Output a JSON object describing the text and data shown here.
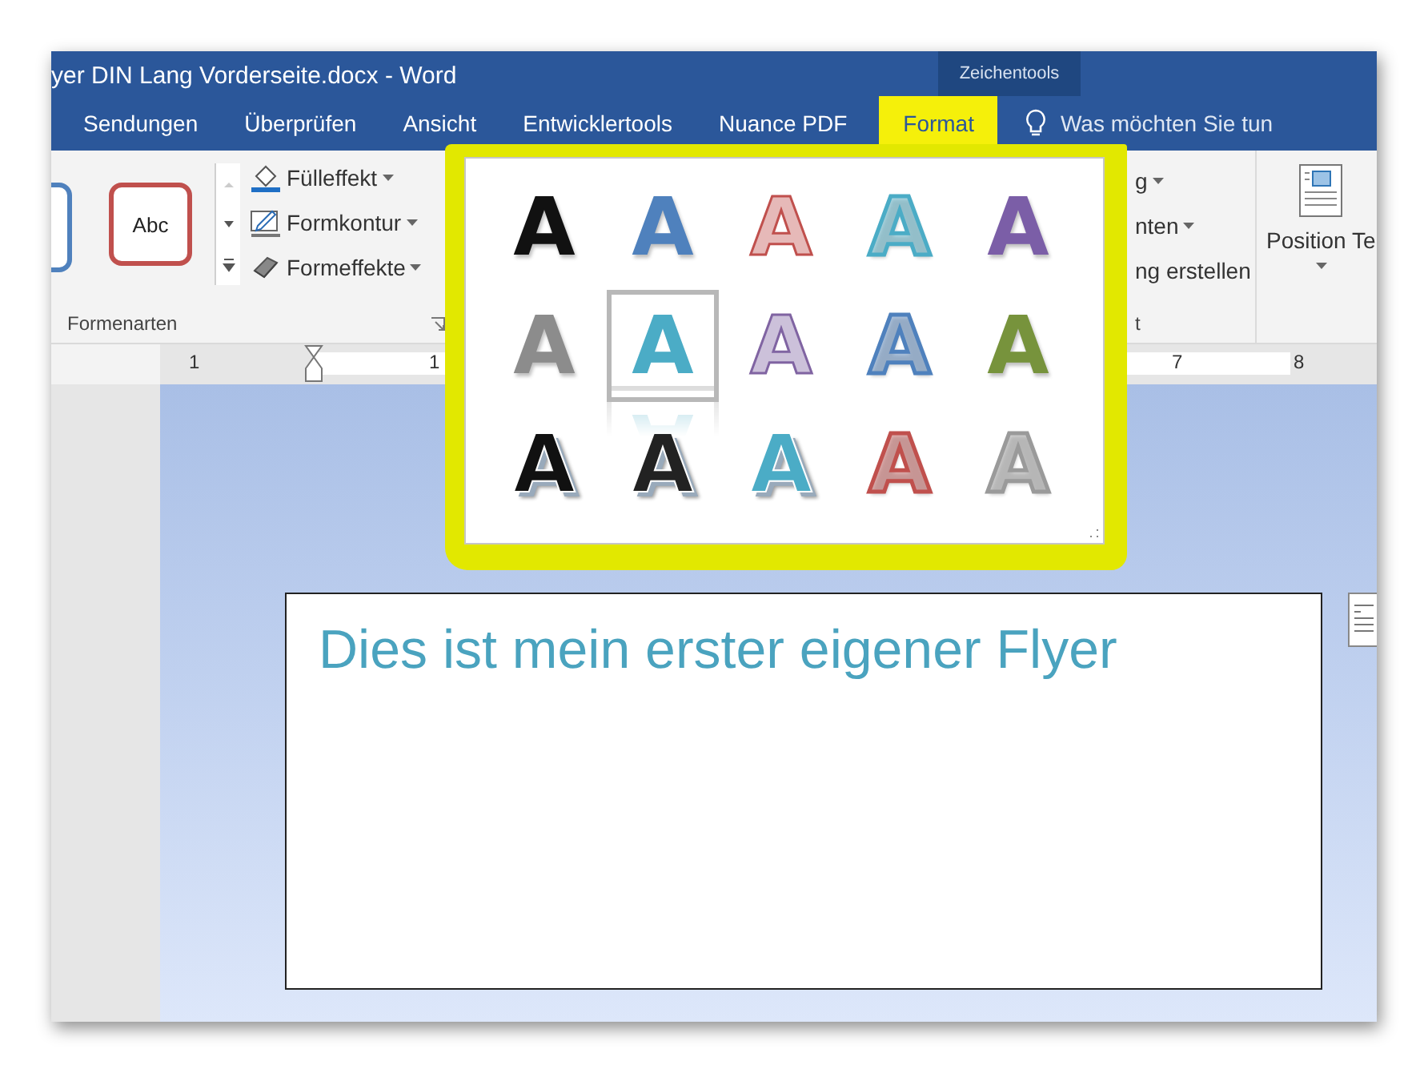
{
  "window": {
    "title": "yer DIN Lang Vorderseite.docx - Word",
    "context_label": "Zeichentools"
  },
  "tabs": [
    {
      "label": "Sendungen",
      "selected": false
    },
    {
      "label": "Überprüfen",
      "selected": false
    },
    {
      "label": "Ansicht",
      "selected": false
    },
    {
      "label": "Entwicklertools",
      "selected": false
    },
    {
      "label": "Nuance PDF",
      "selected": false
    },
    {
      "label": "Format",
      "selected": true
    }
  ],
  "tell_me": {
    "placeholder": "Was möchten Sie tun"
  },
  "ribbon": {
    "shape_styles": {
      "sample": "Abc",
      "group_label": "Formenarten"
    },
    "commands": [
      {
        "label": "Fülleffekt",
        "kind": "fill"
      },
      {
        "label": "Formkontur",
        "kind": "outline"
      },
      {
        "label": "Formeffekte",
        "kind": "effects"
      }
    ],
    "partial_commands": [
      "g",
      "nten",
      "ng erstellen"
    ],
    "partial_group_label": "t",
    "position_button": "Position Te"
  },
  "ruler": {
    "labels": [
      "1",
      "1",
      "7",
      "8"
    ]
  },
  "wordart_gallery": {
    "items": [
      {
        "letter": "A",
        "kind": "solid",
        "color": "#111111",
        "selected": false
      },
      {
        "letter": "A",
        "kind": "solid",
        "color": "#4f81bd",
        "selected": false
      },
      {
        "letter": "A",
        "kind": "filled-outline",
        "color": "#c0504d",
        "selected": false
      },
      {
        "letter": "A",
        "kind": "outline",
        "color": "#4bacc6",
        "selected": false
      },
      {
        "letter": "A",
        "kind": "solid",
        "color": "#7b5ea7",
        "selected": false
      },
      {
        "letter": "A",
        "kind": "solid",
        "color": "#8c8c8c",
        "selected": false
      },
      {
        "letter": "A",
        "kind": "reflection",
        "color": "#4bacc6",
        "selected": true
      },
      {
        "letter": "A",
        "kind": "filled-outline",
        "color": "#8064a2",
        "selected": false
      },
      {
        "letter": "A",
        "kind": "outline",
        "color": "#4f81bd",
        "selected": false
      },
      {
        "letter": "A",
        "kind": "solid",
        "color": "#77933c",
        "selected": false
      },
      {
        "letter": "A",
        "kind": "shadow",
        "color": "#111111",
        "selected": false
      },
      {
        "letter": "A",
        "kind": "shadow",
        "color": "#222222",
        "selected": false
      },
      {
        "letter": "A",
        "kind": "shadow",
        "color": "#4bacc6",
        "selected": false
      },
      {
        "letter": "A",
        "kind": "outline",
        "color": "#c0504d",
        "selected": false
      },
      {
        "letter": "A",
        "kind": "outline",
        "color": "#9a9a9a",
        "selected": false
      }
    ]
  },
  "document": {
    "text_box": "Dies ist mein erster eigener Flyer"
  }
}
